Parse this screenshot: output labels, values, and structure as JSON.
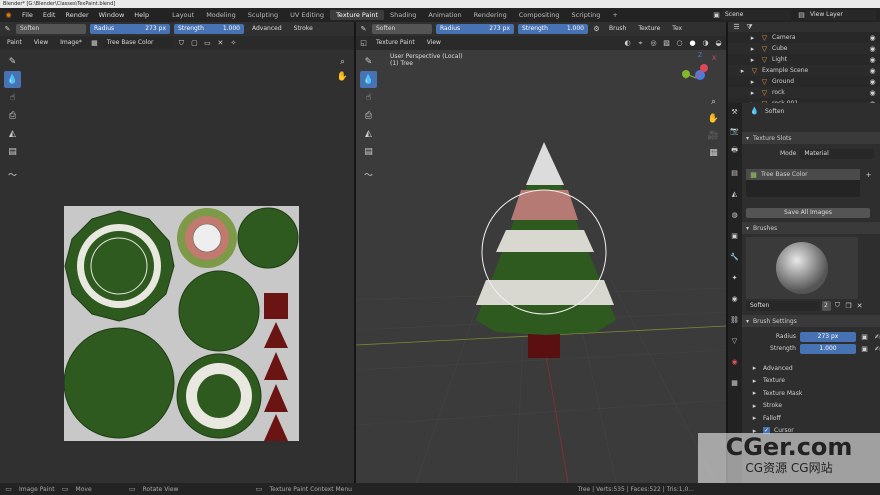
{
  "title_bar": "Blender* [G:\\Blender\\Classes\\TexPaint.blend]",
  "menus": [
    "File",
    "Edit",
    "Render",
    "Window",
    "Help"
  ],
  "workspaces": [
    "Layout",
    "Modeling",
    "Sculpting",
    "UV Editing",
    "Texture Paint",
    "Shading",
    "Animation",
    "Rendering",
    "Compositing",
    "Scripting"
  ],
  "active_workspace": "Texture Paint",
  "scene": "Scene",
  "view_layer": "View Layer",
  "image_editor": {
    "brush": "Soften",
    "radius_label": "Radius",
    "radius_value": "273 px",
    "strength_label": "Strength",
    "strength_value": "1.000",
    "advanced": "Advanced",
    "stroke": "Stroke",
    "mode": "Paint",
    "menu_view": "View",
    "menu_image": "Image*",
    "image_name": "Tree Base Color"
  },
  "viewport": {
    "brush": "Soften",
    "radius_label": "Radius",
    "radius_value": "273 px",
    "strength_label": "Strength",
    "strength_value": "1.000",
    "menu_brush": "Brush",
    "menu_texture": "Texture",
    "menu_tex": "Tex",
    "mode": "Texture Paint",
    "menu_view": "View",
    "overlay_line1": "User Perspective (Local)",
    "overlay_line2": "(1) Tree",
    "gizmo_x": "X",
    "gizmo_y": "Y",
    "gizmo_z": "Z"
  },
  "outliner": {
    "items": [
      {
        "label": "Camera",
        "indent": 2
      },
      {
        "label": "Cube",
        "indent": 2
      },
      {
        "label": "Light",
        "indent": 2
      },
      {
        "label": "Example Scene",
        "indent": 1
      },
      {
        "label": "Ground",
        "indent": 2
      },
      {
        "label": "rock",
        "indent": 2
      },
      {
        "label": "rock.001",
        "indent": 2
      }
    ]
  },
  "properties": {
    "brush_name": "Soften",
    "texture_slots_header": "Texture Slots",
    "mode_label": "Mode",
    "mode_value": "Material",
    "slot_item": "Tree Base Color",
    "save_all": "Save All Images",
    "brushes_header": "Brushes",
    "brush_field": "Soften",
    "brush_users": "2",
    "brush_settings_header": "Brush Settings",
    "radius_label": "Radius",
    "radius_value": "273 px",
    "strength_label": "Strength",
    "strength_value": "1.000",
    "subpanels": [
      "Advanced",
      "Texture",
      "Texture Mask",
      "Stroke",
      "Falloff",
      "Cursor"
    ]
  },
  "status_bar": {
    "left1": "Image Paint",
    "left2": "Move",
    "left3": "Rotate View",
    "left4": "Texture Paint Context Menu",
    "right": "Tree | Verts:535 | Faces:522 | Tris:1,0..."
  },
  "watermark": {
    "main": "CGer.com",
    "sub": "CG资源  CG网站"
  },
  "colors": {
    "accent": "#4772b3",
    "tree_green": "#2f5a1f",
    "trunk": "#6a1414"
  }
}
